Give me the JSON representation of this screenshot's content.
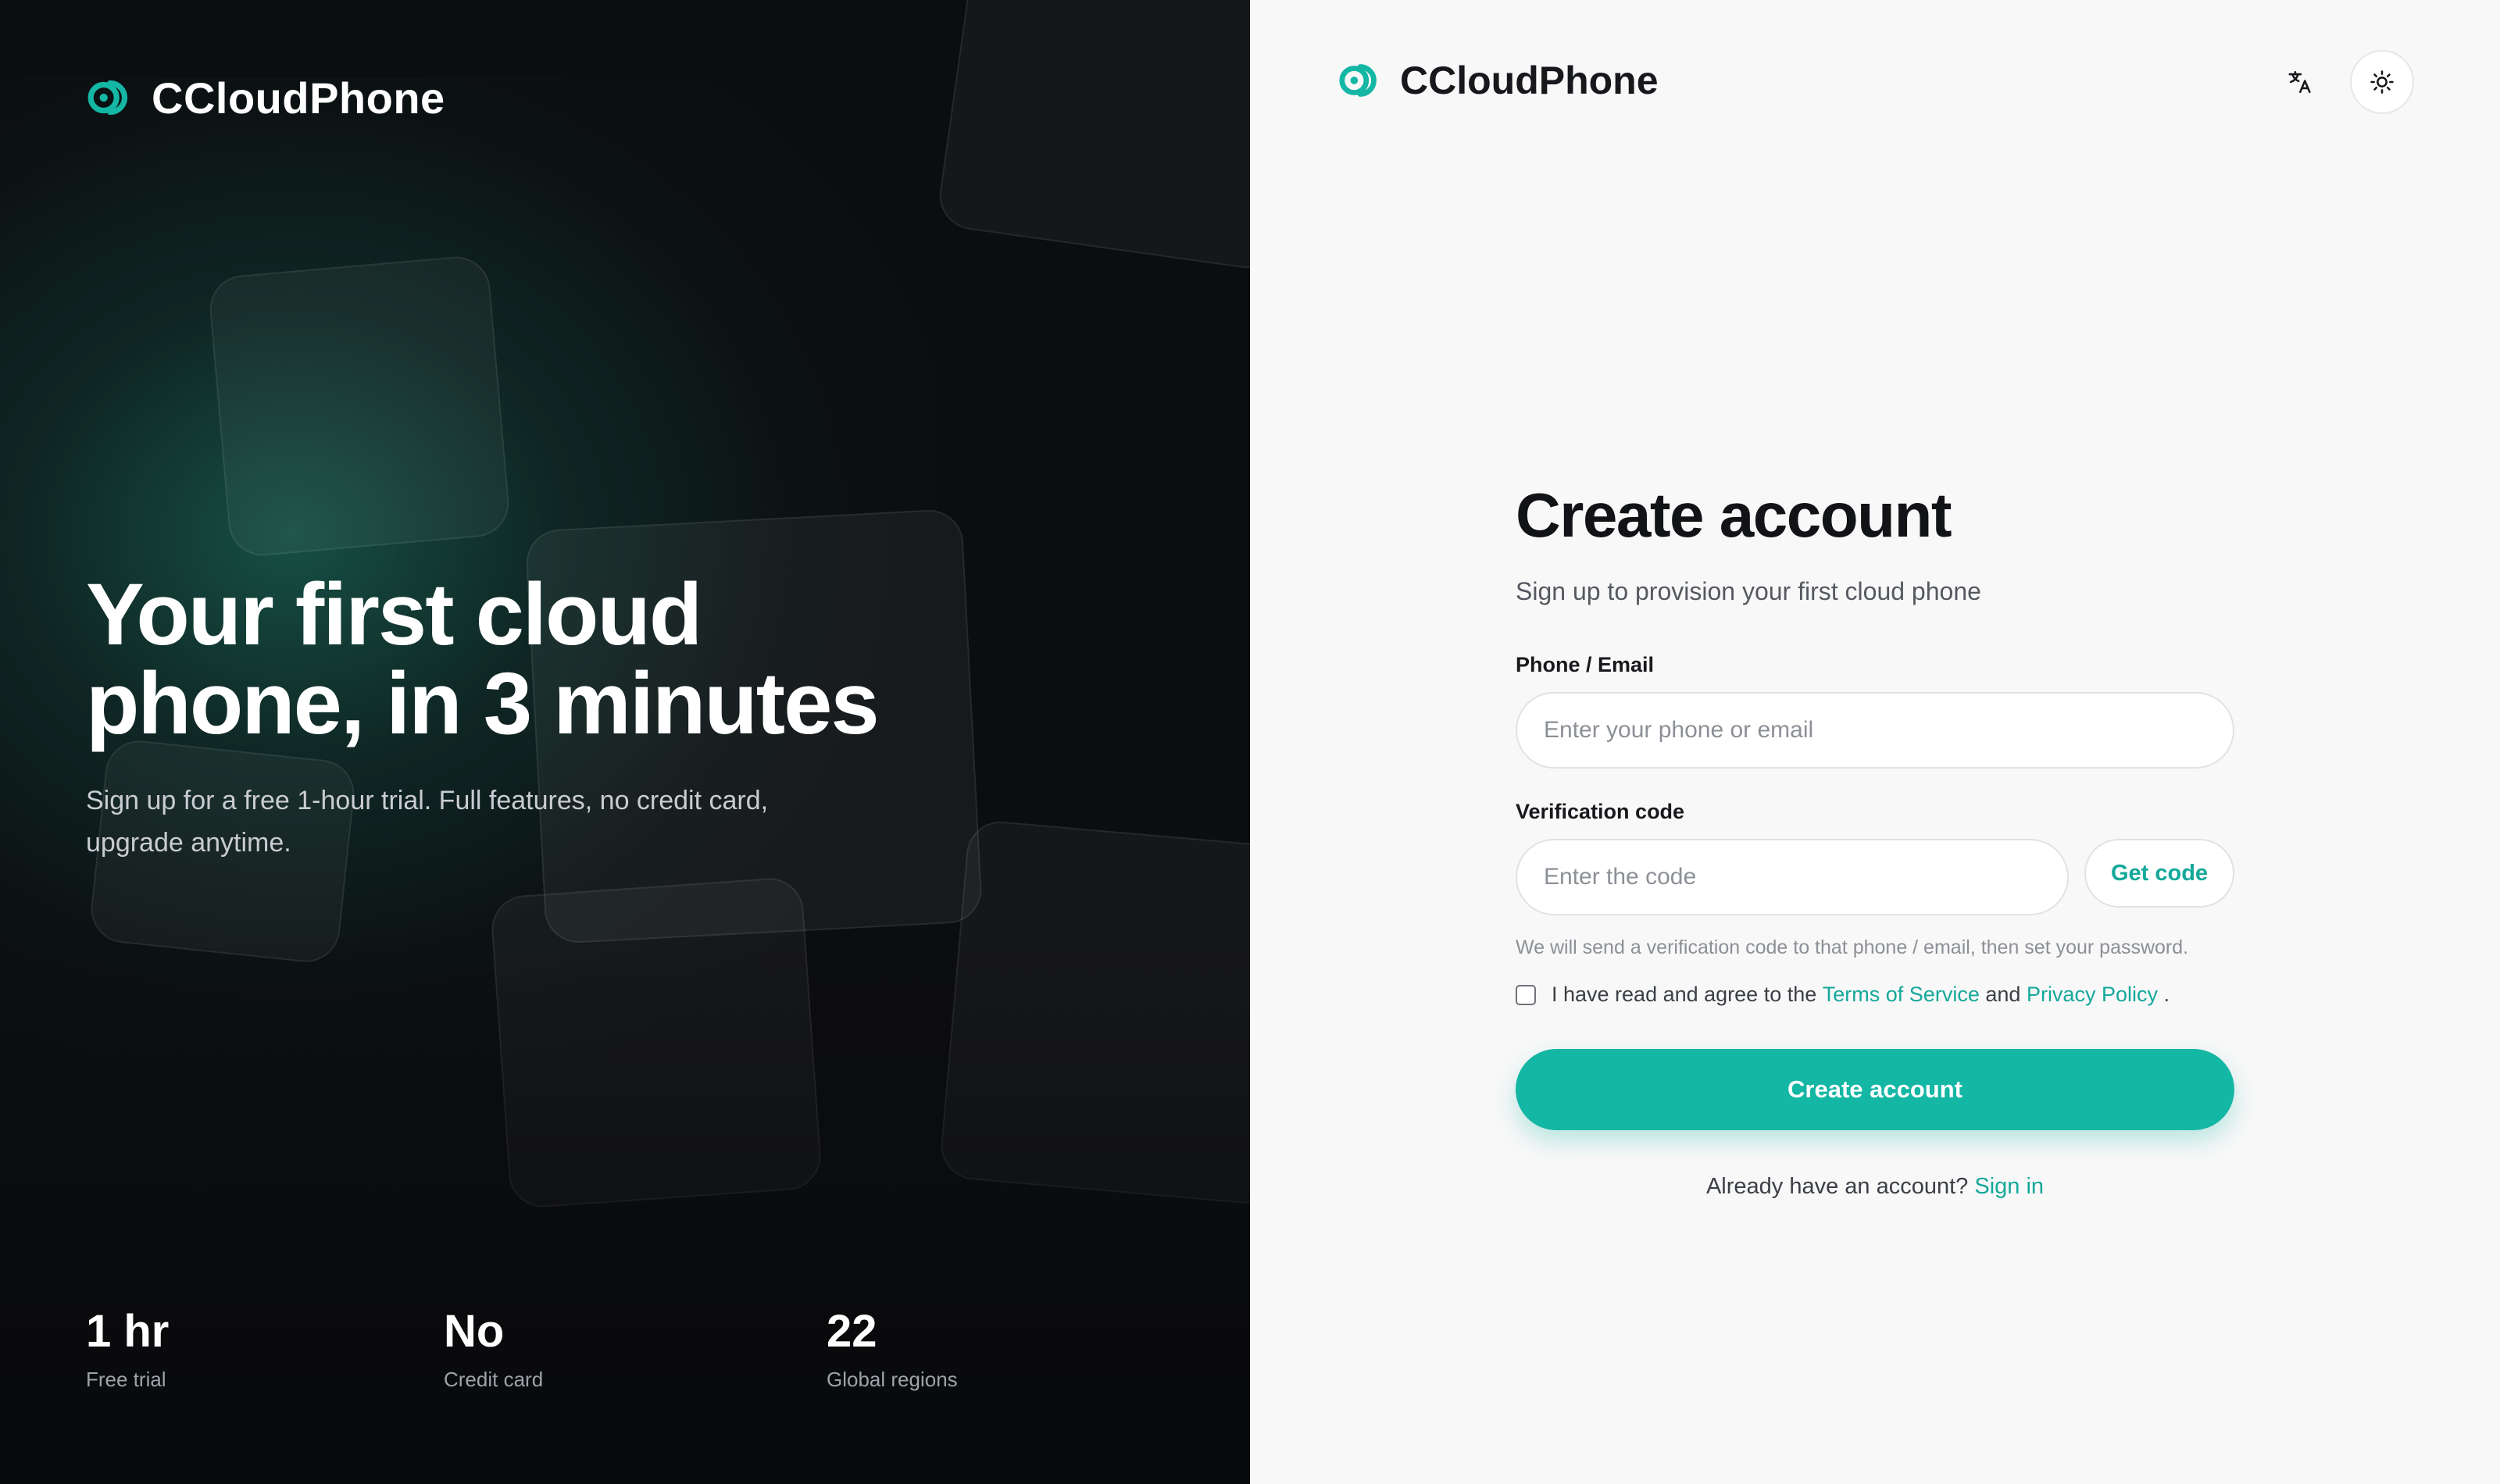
{
  "brand": {
    "name": "CCloudPhone",
    "accent_color": "#14b6a4",
    "logo_icon": "cloudphone-logo-icon"
  },
  "hero": {
    "title": "Your first cloud phone, in 3 minutes",
    "subtitle": "Sign up for a free 1-hour trial. Full features, no credit card, upgrade anytime.",
    "stats": [
      {
        "value": "1 hr",
        "label": "Free trial"
      },
      {
        "value": "No",
        "label": "Credit card"
      },
      {
        "value": "22",
        "label": "Global regions"
      }
    ]
  },
  "toolbar": {
    "language_icon": "translate-icon",
    "theme_icon": "sun-icon"
  },
  "form": {
    "title": "Create account",
    "subtitle": "Sign up to provision your first cloud phone",
    "contact_label": "Phone / Email",
    "contact_placeholder": "Enter your phone or email",
    "code_label": "Verification code",
    "code_placeholder": "Enter the code",
    "get_code_label": "Get code",
    "hint": "We will send a verification code to that phone / email, then set your password.",
    "agree_prefix": "I have read and agree to the",
    "terms_label": "Terms of Service",
    "agree_and": "and",
    "privacy_label": "Privacy Policy",
    "agree_suffix": ".",
    "submit_label": "Create account",
    "signin_prompt": "Already have an account?",
    "signin_label": "Sign in"
  }
}
